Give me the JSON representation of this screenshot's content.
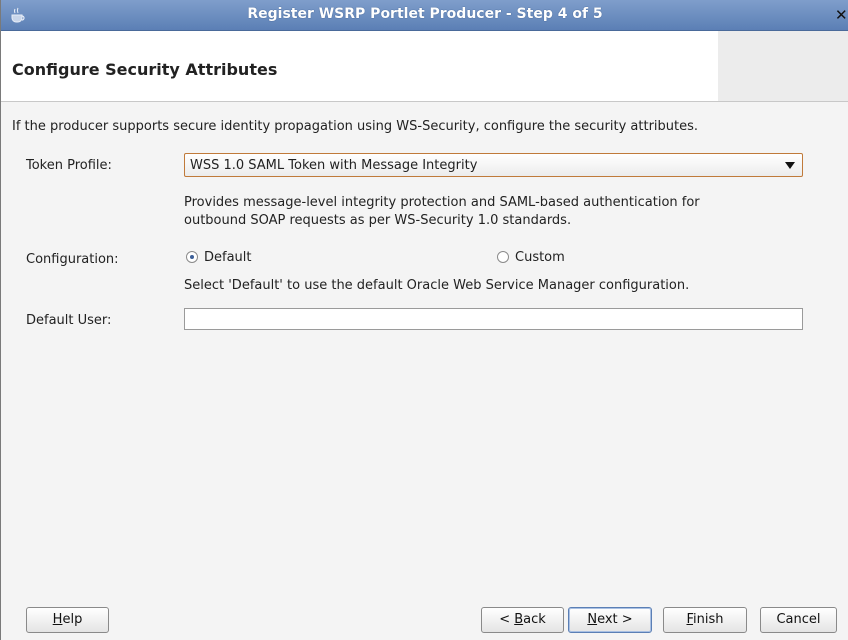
{
  "window": {
    "title": "Register WSRP Portlet Producer - Step 4 of 5",
    "close_glyph": "✕"
  },
  "header": {
    "title": "Configure Security Attributes"
  },
  "content": {
    "intro": "If the producer supports secure identity propagation using WS-Security, configure the security attributes.",
    "token_profile": {
      "label": "Token Profile:",
      "selected": "WSS 1.0 SAML Token with Message Integrity",
      "description_line1": "Provides message-level integrity protection and SAML-based authentication for",
      "description_line2": "outbound SOAP requests as per WS-Security 1.0 standards."
    },
    "configuration": {
      "label": "Configuration:",
      "options": [
        {
          "label": "Default",
          "checked": true
        },
        {
          "label": "Custom",
          "checked": false
        }
      ],
      "hint": "Select 'Default' to use the default Oracle Web Service Manager configuration."
    },
    "default_user": {
      "label": "Default User:",
      "value": ""
    }
  },
  "footer": {
    "help_mnemonic": "H",
    "help_rest": "elp",
    "back_prefix": "< ",
    "back_mnemonic": "B",
    "back_rest": "ack",
    "next_mnemonic": "N",
    "next_rest": "ext >",
    "finish_mnemonic": "F",
    "finish_rest": "inish",
    "cancel": "Cancel"
  },
  "colors": {
    "titlebar": "#5b7fb5",
    "select_border": "#c07a3a",
    "radio_dot": "#3c5f98"
  }
}
